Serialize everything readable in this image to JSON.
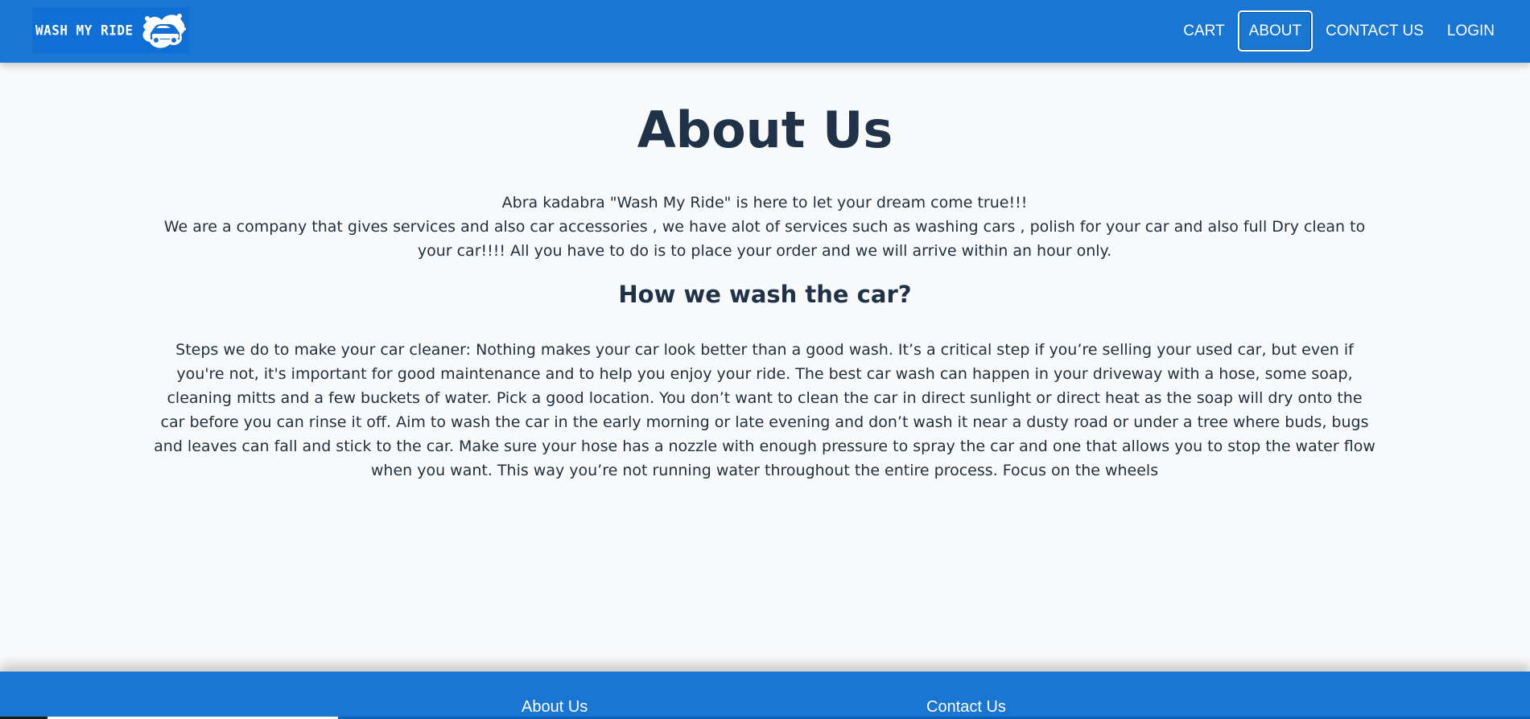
{
  "header": {
    "logo_text": "WASH MY RIDE",
    "nav": {
      "cart": "CART",
      "about": "ABOUT",
      "contact": "CONTACT US",
      "login": "LOGIN"
    }
  },
  "main": {
    "title": "About Us",
    "intro_line_1": "Abra kadabra \"Wash My Ride\" is here to let your dream come true!!!",
    "intro_line_2": "We are a company that gives services and also car accessories , we have alot of services such as washing cars , polish for your car and also full Dry clean to your car!!!! All you have to do is to place your order and we will arrive within an hour only.",
    "subheading": "How we wash the car?",
    "steps": "Steps we do to make your car cleaner: Nothing makes your car look better than a good wash. It’s a critical step if you’re selling your used car, but even if you're not, it's important for good maintenance and to help you enjoy your ride. The best car wash can happen in your driveway with a hose, some soap, cleaning mitts and a few buckets of water. Pick a good location. You don’t want to clean the car in direct sunlight or direct heat as the soap will dry onto the car before you can rinse it off. Aim to wash the car in the early morning or late evening and don’t wash it near a dusty road or under a tree where buds, bugs and leaves can fall and stick to the car. Make sure your hose has a nozzle with enough pressure to spray the car and one that allows you to stop the water flow when you want. This way you’re not running water throughout the entire process. Focus on the wheels"
  },
  "footer": {
    "about_heading": "About Us",
    "contact_heading": "Contact Us"
  },
  "colors": {
    "brand_blue": "#1976d2",
    "page_background": "#f8f9fa",
    "heading_text": "#203248",
    "body_text": "#22303f"
  },
  "icons": {
    "logo_mark": "car-wash-icon"
  }
}
